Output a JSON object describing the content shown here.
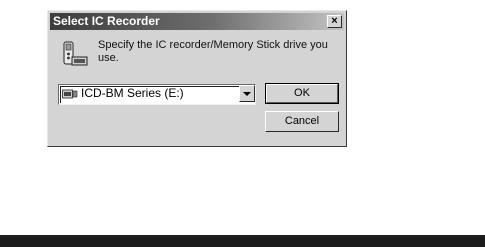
{
  "dialog": {
    "title": "Select IC Recorder",
    "close_glyph": "×",
    "prompt": "Specify the IC recorder/Memory Stick drive you use.",
    "icon": "ic-recorder-icon",
    "combo": {
      "selected": "ICD-BM Series (E:)",
      "icon": "recorder-device-icon"
    },
    "ok_label": "OK",
    "cancel_label": "Cancel"
  }
}
